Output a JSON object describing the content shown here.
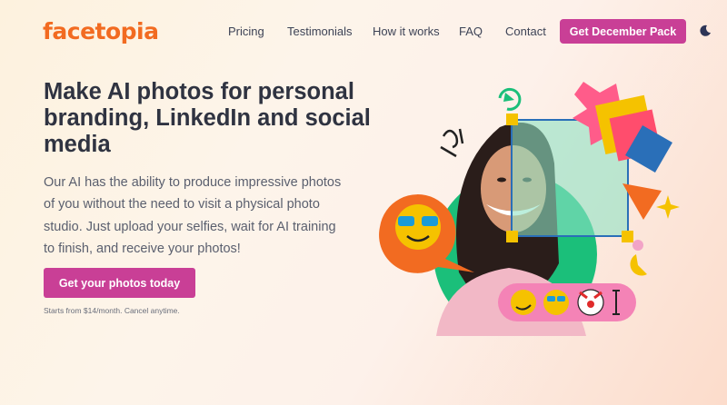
{
  "brand": {
    "logo_text": "facetopia"
  },
  "nav": {
    "links": [
      "Pricing",
      "Testimonials",
      "How it works",
      "FAQ",
      "Contact"
    ],
    "cta_label": "Get December Pack",
    "theme_toggle_icon": "moon-icon"
  },
  "hero": {
    "title": "Make AI photos for personal branding, LinkedIn and social media",
    "description": "Our AI has the ability to produce impressive photos of you without the need to visit a physical photo studio. Just upload your selfies, wait for AI training to finish, and receive your photos!",
    "cta_label": "Get your photos today",
    "note": "Starts from $14/month. Cancel anytime."
  },
  "colors": {
    "brand_orange": "#f26b21",
    "accent_pink": "#c93f96"
  }
}
